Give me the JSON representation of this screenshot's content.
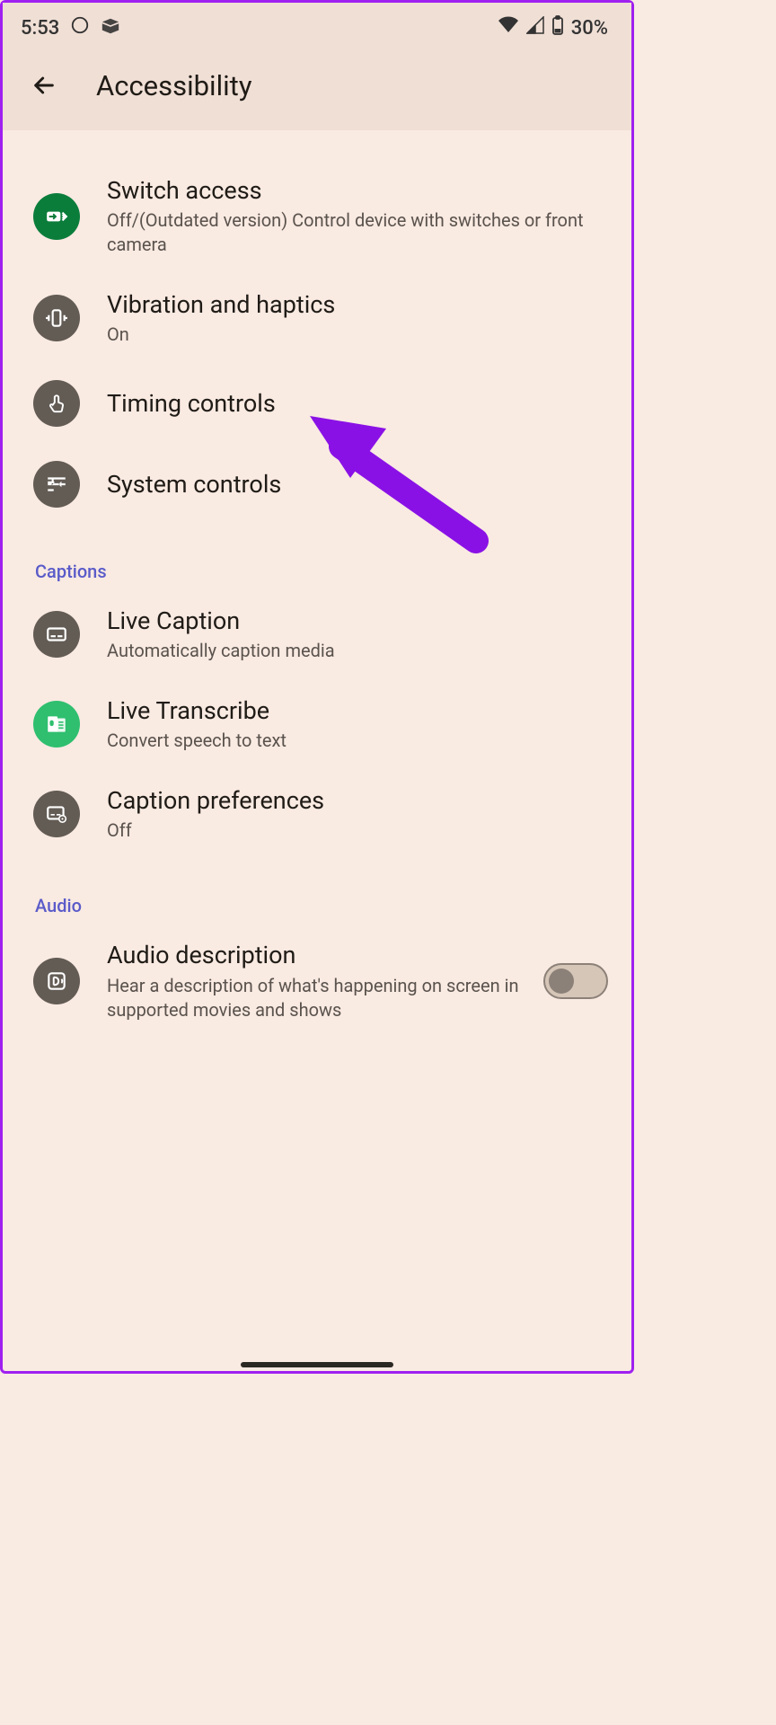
{
  "status": {
    "time": "5:53",
    "battery": "30%"
  },
  "header": {
    "title": "Accessibility"
  },
  "sections": {
    "top_items": [
      {
        "title": "Switch access",
        "sub": "Off/(Outdated version) Control device with switches or front camera"
      },
      {
        "title": "Vibration and haptics",
        "sub": "On"
      },
      {
        "title": "Timing controls",
        "sub": ""
      },
      {
        "title": "System controls",
        "sub": ""
      }
    ],
    "captions_label": "Captions",
    "captions_items": [
      {
        "title": "Live Caption",
        "sub": "Automatically caption media"
      },
      {
        "title": "Live Transcribe",
        "sub": "Convert speech to text"
      },
      {
        "title": "Caption preferences",
        "sub": "Off"
      }
    ],
    "audio_label": "Audio",
    "audio_items": [
      {
        "title": "Audio description",
        "sub": "Hear a description of what's happening on screen in supported movies and shows"
      }
    ]
  }
}
